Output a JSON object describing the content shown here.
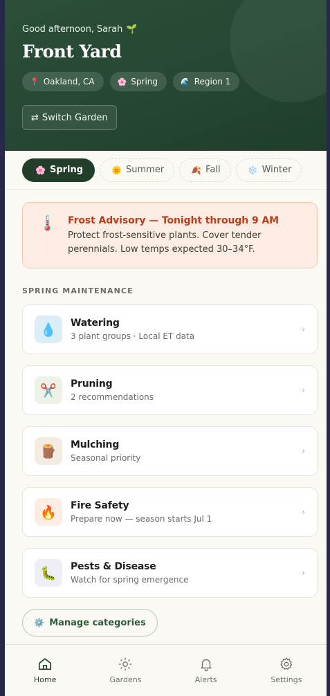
{
  "header": {
    "greeting": "Good afternoon, Sarah",
    "greeting_icon": "🌱",
    "title": "Front Yard",
    "chips": [
      {
        "icon": "📍",
        "label": "Oakland, CA"
      },
      {
        "icon": "🌸",
        "label": "Spring"
      },
      {
        "icon": "🌊",
        "label": "Region 1"
      }
    ],
    "switch_icon": "⇄",
    "switch_label": "Switch Garden"
  },
  "seasons": [
    {
      "icon": "🌸",
      "label": "Spring",
      "active": true
    },
    {
      "icon": "🌞",
      "label": "Summer",
      "active": false
    },
    {
      "icon": "🍂",
      "label": "Fall",
      "active": false
    },
    {
      "icon": "❄️",
      "label": "Winter",
      "active": false
    }
  ],
  "alert": {
    "icon": "🌡️",
    "title": "Frost Advisory — Tonight through 9 AM",
    "text": "Protect frost-sensitive plants. Cover tender perennials. Low temps expected 30–34°F."
  },
  "section": {
    "label": "SPRING MAINTENANCE"
  },
  "categories": [
    {
      "icon": "💧",
      "title": "Watering",
      "subtitle": "3 plant groups · Local ET data",
      "bg": "#dbeef7"
    },
    {
      "icon": "✂️",
      "title": "Pruning",
      "subtitle": "2 recommendations",
      "bg": "#eef2e6"
    },
    {
      "icon": "🪵",
      "title": "Mulching",
      "subtitle": "Seasonal priority",
      "bg": "#f4ece1"
    },
    {
      "icon": "🔥",
      "title": "Fire Safety",
      "subtitle": "Prepare now — season starts Jul 1",
      "bg": "#fdece2"
    },
    {
      "icon": "🐛",
      "title": "Pests & Disease",
      "subtitle": "Watch for spring emergence",
      "bg": "#eeeef6"
    }
  ],
  "chevron": "›",
  "manage": {
    "icon": "⚙️",
    "label": "Manage categories"
  },
  "nav": [
    {
      "label": "Home",
      "icon": "home-icon",
      "active": true
    },
    {
      "label": "Gardens",
      "icon": "sun-icon",
      "active": false
    },
    {
      "label": "Alerts",
      "icon": "bell-icon",
      "active": false
    },
    {
      "label": "Settings",
      "icon": "gear-icon",
      "active": false
    }
  ],
  "colors": {
    "header_green": "#254733",
    "active_tab": "#223e2b",
    "alert_title": "#bc3d1a",
    "alert_bg": "#fcece3",
    "manage_text": "#2f5b3b"
  }
}
